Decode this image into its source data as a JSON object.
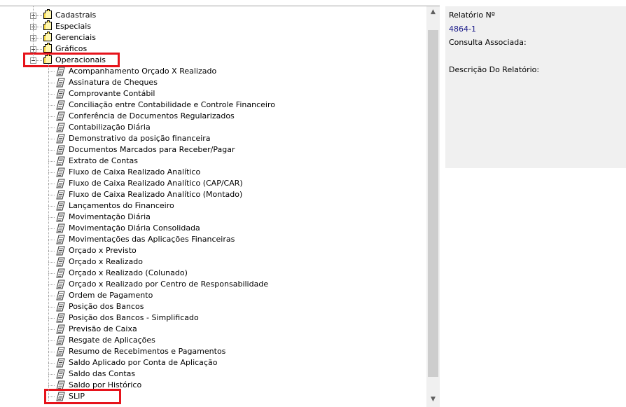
{
  "tree": {
    "categories": [
      {
        "label": "Cadastrais",
        "expanded": false
      },
      {
        "label": "Especiais",
        "expanded": false
      },
      {
        "label": "Gerenciais",
        "expanded": false
      },
      {
        "label": "Gráficos",
        "expanded": false
      },
      {
        "label": "Operacionais",
        "expanded": true,
        "highlighted": true
      }
    ],
    "reports": [
      {
        "label": "Acompanhamento Orçado X Realizado"
      },
      {
        "label": "Assinatura de Cheques"
      },
      {
        "label": "Comprovante Contábil"
      },
      {
        "label": "Conciliação entre Contabilidade e Controle Financeiro"
      },
      {
        "label": "Conferência de Documentos Regularizados"
      },
      {
        "label": "Contabilização Diária"
      },
      {
        "label": "Demonstrativo da posição financeira"
      },
      {
        "label": "Documentos Marcados para Receber/Pagar"
      },
      {
        "label": "Extrato de Contas"
      },
      {
        "label": "Fluxo de Caixa Realizado Analítico"
      },
      {
        "label": "Fluxo de Caixa Realizado Analítico (CAP/CAR)"
      },
      {
        "label": "Fluxo de Caixa Realizado Analítico (Montado)"
      },
      {
        "label": "Lançamentos do Financeiro"
      },
      {
        "label": "Movimentação Diária"
      },
      {
        "label": "Movimentação Diária Consolidada"
      },
      {
        "label": "Movimentações das Aplicações Financeiras"
      },
      {
        "label": "Orçado x Previsto"
      },
      {
        "label": "Orçado x Realizado"
      },
      {
        "label": "Orçado x Realizado (Colunado)"
      },
      {
        "label": "Orçado x Realizado por Centro de Responsabilidade"
      },
      {
        "label": "Ordem de Pagamento"
      },
      {
        "label": "Posição dos Bancos"
      },
      {
        "label": "Posição dos Bancos - Simplificado"
      },
      {
        "label": "Previsão de Caixa"
      },
      {
        "label": "Resgate de Aplicações"
      },
      {
        "label": "Resumo de Recebimentos e Pagamentos"
      },
      {
        "label": "Saldo Aplicado por Conta de Aplicação"
      },
      {
        "label": "Saldo das Contas"
      },
      {
        "label": "Saldo por Histórico"
      },
      {
        "label": "SLIP",
        "highlighted": true
      }
    ],
    "icons": {
      "category": "folder-icon",
      "report": "report-icon"
    }
  },
  "scrollbar": {
    "up_glyph": "▲",
    "down_glyph": "▼"
  },
  "info_panel": {
    "report_number_label": "Relatório Nº",
    "report_number_value": "4864-1",
    "associated_query_label": "Consulta Associada:",
    "associated_query_value": "",
    "description_label": "Descrição Do Relatório:",
    "description_value": ""
  },
  "colors": {
    "highlight": "#e6131b",
    "value_text": "#1c1c8a",
    "panel_bg": "#f0f0f0",
    "folder_fill": "#f6d53b"
  }
}
